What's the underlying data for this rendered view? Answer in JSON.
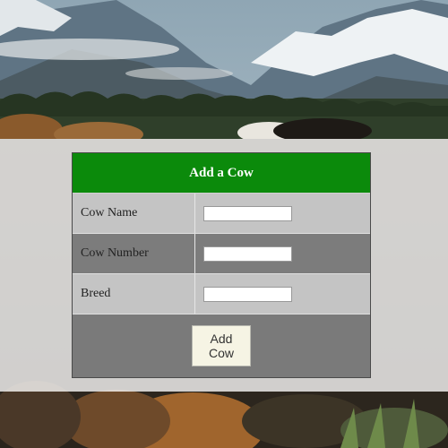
{
  "form": {
    "title": "Add a Cow",
    "fields": [
      {
        "label": "Cow Name",
        "value": ""
      },
      {
        "label": "Cow Number",
        "value": ""
      },
      {
        "label": "Breed",
        "value": ""
      }
    ],
    "submit_label": "Add Cow"
  },
  "colors": {
    "header_bg": "#0b8a0b",
    "header_text": "#ffffff",
    "row_light": "#c4c4c4",
    "row_dark": "#7c7c7c",
    "button_bg": "#f6f4e4"
  }
}
